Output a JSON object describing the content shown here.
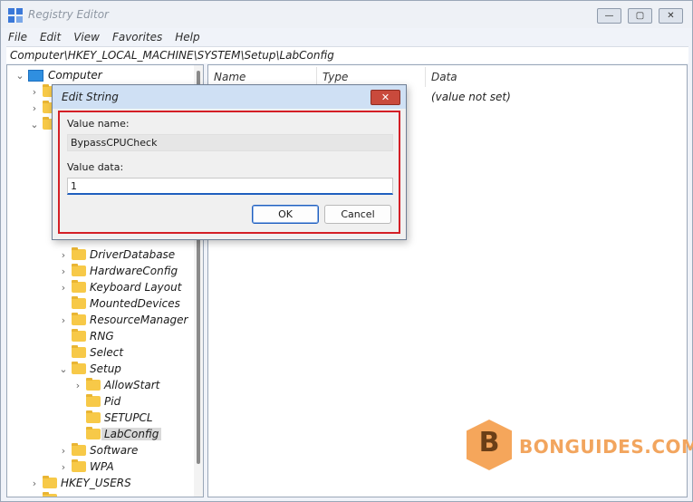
{
  "window": {
    "title": "Registry Editor",
    "controls": [
      "—",
      "▢",
      "✕"
    ]
  },
  "menu": [
    "File",
    "Edit",
    "View",
    "Favorites",
    "Help"
  ],
  "address": "Computer\\HKEY_LOCAL_MACHINE\\SYSTEM\\Setup\\LabConfig",
  "tree": {
    "root": "Computer",
    "items": [
      {
        "label": "DriverDatabase"
      },
      {
        "label": "HardwareConfig"
      },
      {
        "label": "Keyboard Layout"
      },
      {
        "label": "MountedDevices"
      },
      {
        "label": "ResourceManager"
      },
      {
        "label": "RNG"
      },
      {
        "label": "Select"
      },
      {
        "label": "Setup"
      },
      {
        "label": "AllowStart"
      },
      {
        "label": "Pid"
      },
      {
        "label": "SETUPCL"
      },
      {
        "label": "LabConfig"
      },
      {
        "label": "Software"
      },
      {
        "label": "WPA"
      },
      {
        "label": "HKEY_USERS"
      }
    ]
  },
  "list": {
    "columns": [
      "Name",
      "Type",
      "Data"
    ],
    "rows": [
      {
        "data": "(value not set)"
      }
    ]
  },
  "dialog": {
    "title": "Edit String",
    "close": "✕",
    "value_name_label": "Value name:",
    "value_name": "BypassCPUCheck",
    "value_data_label": "Value data:",
    "value_data": "1",
    "ok": "OK",
    "cancel": "Cancel"
  },
  "watermark": {
    "letter": "B",
    "text": "BONGUIDES.COM"
  },
  "colors": {
    "highlight_border": "#d41f26",
    "folder": "#f7c948",
    "accent": "#1f5fbf"
  }
}
